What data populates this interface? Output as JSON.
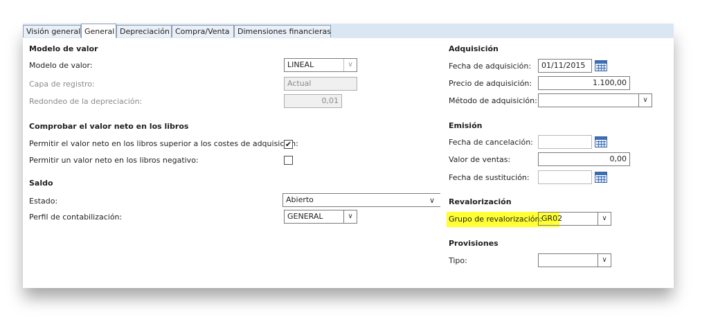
{
  "tabs": [
    "Visión general",
    "General",
    "Depreciación",
    "Compra/Venta",
    "Dimensiones financieras"
  ],
  "active_tab": "General",
  "left": {
    "value_model": {
      "header": "Modelo de valor",
      "model_label": "Modelo de valor:",
      "model_value": "LINEAL",
      "layer_label": "Capa de registro:",
      "layer_value": "Actual",
      "rounding_label": "Redondeo de la depreciación:",
      "rounding_value": "0,01"
    },
    "book_value": {
      "header": "Comprobar el valor neto en los libros",
      "allow_above_label": "Permitir el valor neto en los libros superior a los costes de adquisición:",
      "allow_above_checked": "✔",
      "allow_negative_label": "Permitir un valor neto en los libros negativo:"
    },
    "balance": {
      "header": "Saldo",
      "status_label": "Estado:",
      "status_value": "Abierto",
      "profile_label": "Perfil de contabilización:",
      "profile_value": "GENERAL"
    }
  },
  "right": {
    "acquisition": {
      "header": "Adquisición",
      "date_label": "Fecha de adquisición:",
      "date_value": "01/11/2015",
      "price_label": "Precio de adquisición:",
      "price_value": "1.100,00",
      "method_label": "Método de adquisición:",
      "method_value": ""
    },
    "disposal": {
      "header": "Emisión",
      "cancel_date_label": "Fecha de cancelación:",
      "cancel_date_value": "",
      "sales_value_label": "Valor de ventas:",
      "sales_value": "0,00",
      "replacement_date_label": "Fecha de sustitución:",
      "replacement_date_value": ""
    },
    "revaluation": {
      "header": "Revalorización",
      "group_label": "Grupo de revalorización:",
      "group_value": "GR02"
    },
    "provisions": {
      "header": "Provisiones",
      "type_label": "Tipo:",
      "type_value": ""
    }
  },
  "icons": {
    "dropdown": "chevron-down-icon",
    "calendar": "calendar-icon",
    "checkbox": "checkmark-icon"
  },
  "colors": {
    "tabbar_bg": "#dbe6f3",
    "highlight": "#ffff33",
    "calendar_blue": "#3a6fb8"
  }
}
